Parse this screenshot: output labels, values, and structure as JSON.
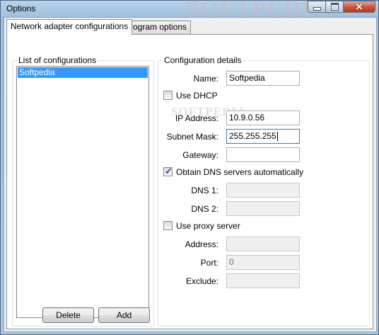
{
  "window": {
    "title": "Options"
  },
  "watermark": {
    "text": "SOFTPEDIA",
    "small_text": "SOFTPEDIA"
  },
  "tabs": [
    {
      "label": "Network adapter configurations",
      "active": true
    },
    {
      "label": "Program options",
      "active": false
    }
  ],
  "list_group": {
    "label": "List of configurations",
    "items": [
      "Softpedia"
    ],
    "selected": "Softpedia",
    "delete_label": "Delete",
    "add_label": "Add"
  },
  "details": {
    "label": "Configuration details",
    "name_label": "Name:",
    "name_value": "Softpedia",
    "use_dhcp_label": "Use DHCP",
    "use_dhcp_checked": false,
    "ip_label": "IP Address:",
    "ip_value": "10.9.0.56",
    "subnet_label": "Subnet Mask:",
    "subnet_value": "255.255.255",
    "gateway_label": "Gateway:",
    "gateway_value": "",
    "obtain_dns_label": "Obtain DNS servers automatically",
    "obtain_dns_checked": true,
    "dns1_label": "DNS 1:",
    "dns1_value": "",
    "dns2_label": "DNS 2:",
    "dns2_value": "",
    "use_proxy_label": "Use proxy server",
    "use_proxy_checked": false,
    "address_label": "Address:",
    "address_value": "",
    "port_label": "Port:",
    "port_value": "0",
    "exclude_label": "Exclude:",
    "exclude_value": ""
  },
  "icons": {
    "minimize": "minimize-icon",
    "maximize": "maximize-icon",
    "close": "close-icon",
    "check": "checkmark-icon"
  },
  "colors": {
    "selection": "#3399ff",
    "close_button": "#c7523a",
    "title_bar": "#a8c6e0"
  }
}
